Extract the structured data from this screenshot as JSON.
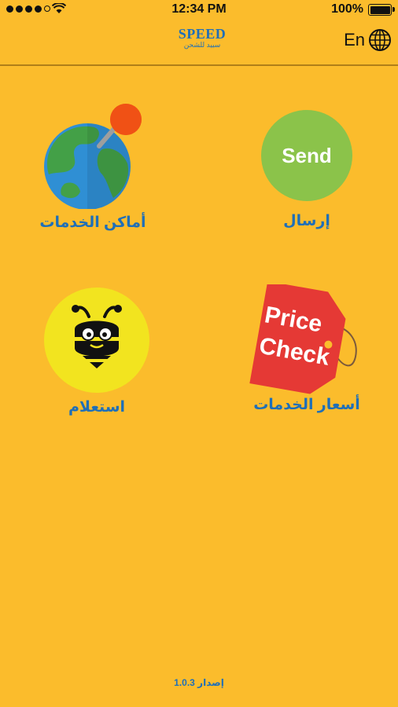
{
  "status_bar": {
    "time": "12:34 PM",
    "battery": "100%"
  },
  "header": {
    "logo_main": "SPEED",
    "logo_sub": "سبيد للشحن",
    "language": "En"
  },
  "tiles": [
    {
      "label": "أماكن الخدمات",
      "icon": "globe-pin-icon"
    },
    {
      "label": "إرسال",
      "icon_text": "Send"
    },
    {
      "label": "استعلام",
      "icon": "bee-icon"
    },
    {
      "label": "أسعار الخدمات",
      "icon_text_1": "Price",
      "icon_text_2": "Check"
    }
  ],
  "footer": {
    "version": "إصدار 1.0.3"
  },
  "colors": {
    "background": "#FBBC2C",
    "label": "#1F6FB8",
    "send": "#8BC34A",
    "bee": "#F2E41F",
    "tag": "#E53935"
  }
}
